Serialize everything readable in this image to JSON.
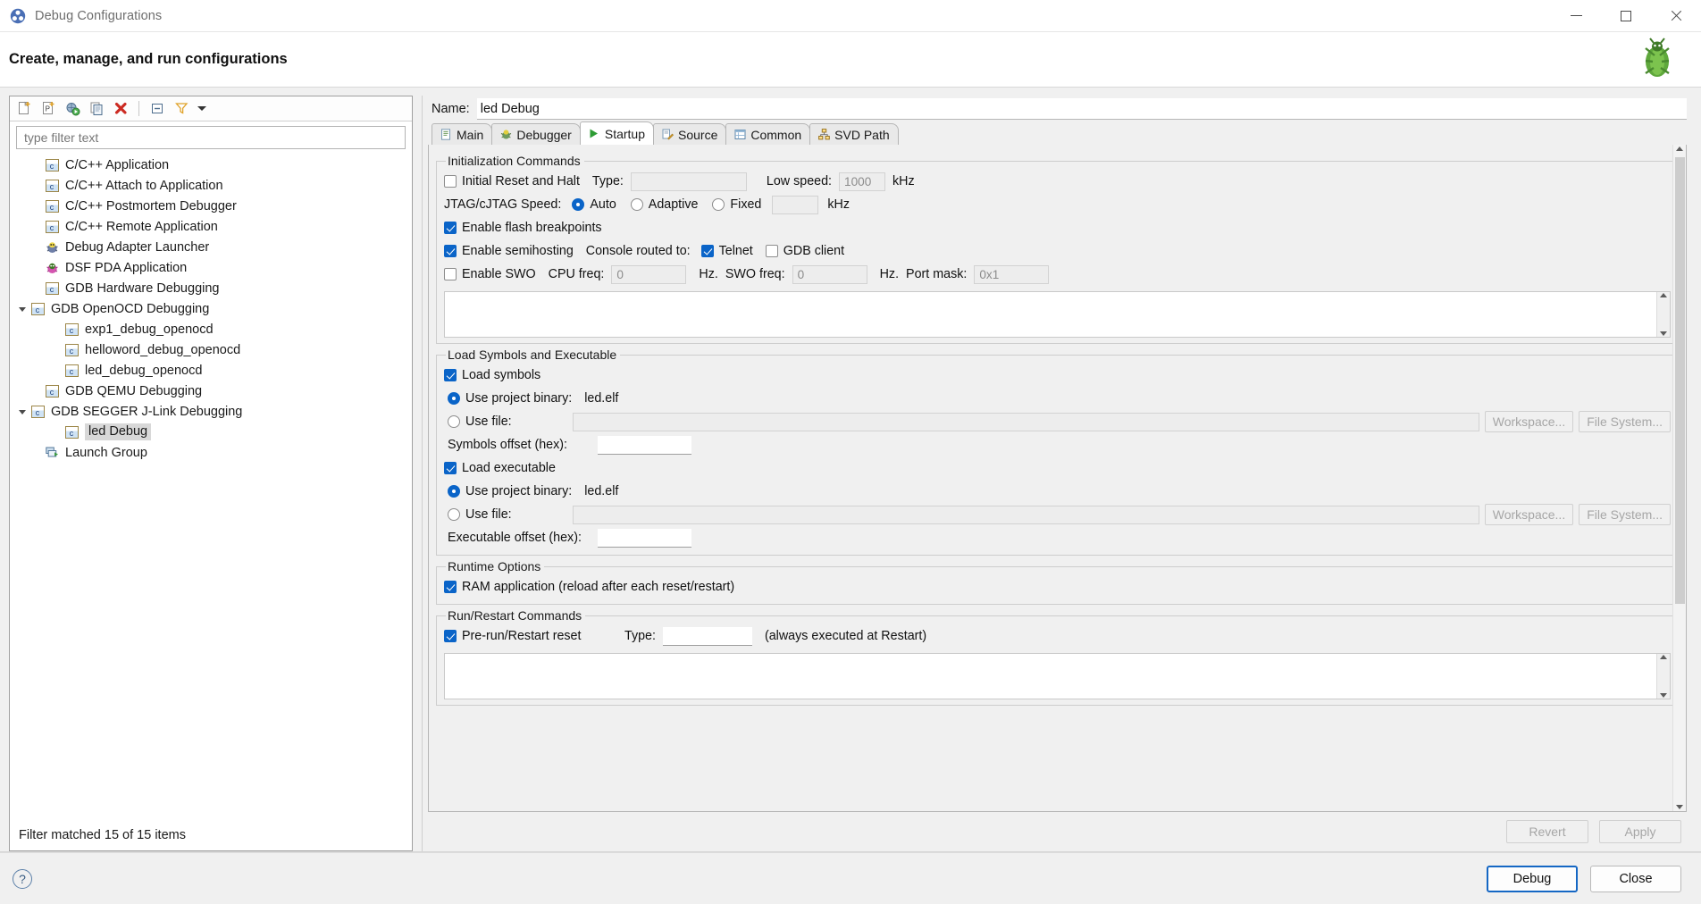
{
  "window": {
    "title": "Debug Configurations",
    "icon": "debug-configurations-icon",
    "minimize": "minimize-icon",
    "maximize": "maximize-icon",
    "close": "close-icon"
  },
  "banner": {
    "title": "Create, manage, and run configurations",
    "image": "bug-illustration"
  },
  "left": {
    "toolbar": [
      {
        "name": "new-launch-configuration-icon",
        "glyph": "❐"
      },
      {
        "name": "new-prototype-icon",
        "glyph": "P"
      },
      {
        "name": "export-icon",
        "glyph": "◐"
      },
      {
        "name": "duplicate-icon",
        "glyph": "⧉"
      },
      {
        "name": "delete-icon",
        "glyph": "✖"
      },
      {
        "name": "collapse-all-icon",
        "glyph": "⊟"
      },
      {
        "name": "filter-icon",
        "glyph": "▽"
      },
      {
        "name": "view-menu-caret-icon",
        "glyph": "▾"
      }
    ],
    "filter": {
      "placeholder": "type filter text",
      "value": ""
    },
    "tree": [
      {
        "label": "C/C++ Application",
        "icon": "c-config-icon",
        "indent": 1,
        "twisty": "",
        "selected": false
      },
      {
        "label": "C/C++ Attach to Application",
        "icon": "c-config-icon",
        "indent": 1,
        "twisty": "",
        "selected": false
      },
      {
        "label": "C/C++ Postmortem Debugger",
        "icon": "c-config-icon",
        "indent": 1,
        "twisty": "",
        "selected": false
      },
      {
        "label": "C/C++ Remote Application",
        "icon": "c-config-icon",
        "indent": 1,
        "twisty": "",
        "selected": false
      },
      {
        "label": "Debug Adapter Launcher",
        "icon": "bug-blue-icon",
        "indent": 1,
        "twisty": "",
        "selected": false
      },
      {
        "label": "DSF PDA Application",
        "icon": "bug-pink-icon",
        "indent": 1,
        "twisty": "",
        "selected": false
      },
      {
        "label": "GDB Hardware Debugging",
        "icon": "c-config-icon",
        "indent": 1,
        "twisty": "",
        "selected": false
      },
      {
        "label": "GDB OpenOCD Debugging",
        "icon": "c-config-icon",
        "indent": 0,
        "twisty": "open",
        "selected": false
      },
      {
        "label": "exp1_debug_openocd",
        "icon": "c-config-icon",
        "indent": 2,
        "twisty": "",
        "selected": false
      },
      {
        "label": "helloword_debug_openocd",
        "icon": "c-config-icon",
        "indent": 2,
        "twisty": "",
        "selected": false
      },
      {
        "label": "led_debug_openocd",
        "icon": "c-config-icon",
        "indent": 2,
        "twisty": "",
        "selected": false
      },
      {
        "label": "GDB QEMU Debugging",
        "icon": "c-config-icon",
        "indent": 1,
        "twisty": "",
        "selected": false
      },
      {
        "label": "GDB SEGGER J-Link Debugging",
        "icon": "c-config-icon",
        "indent": 0,
        "twisty": "open",
        "selected": false
      },
      {
        "label": "led Debug",
        "icon": "c-config-icon",
        "indent": 2,
        "twisty": "",
        "selected": true
      },
      {
        "label": "Launch Group",
        "icon": "launch-group-icon",
        "indent": 1,
        "twisty": "",
        "selected": false
      }
    ],
    "status": "Filter matched 15 of 15 items"
  },
  "right": {
    "name_label": "Name:",
    "name_value": "led Debug",
    "tabs": [
      {
        "label": "Main",
        "icon": "document-icon",
        "active": false
      },
      {
        "label": "Debugger",
        "icon": "debugger-icon",
        "active": false
      },
      {
        "label": "Startup",
        "icon": "play-icon",
        "active": true
      },
      {
        "label": "Source",
        "icon": "source-icon",
        "active": false
      },
      {
        "label": "Common",
        "icon": "common-icon",
        "active": false
      },
      {
        "label": "SVD Path",
        "icon": "svd-icon",
        "active": false
      }
    ],
    "startup": {
      "init_group": {
        "legend": "Initialization Commands",
        "initial_reset_label": "Initial Reset and Halt",
        "initial_reset_checked": false,
        "type_label": "Type:",
        "type_value": "",
        "low_speed_label": "Low speed:",
        "low_speed_value": "1000",
        "low_speed_unit": "kHz",
        "jtag_label": "JTAG/cJTAG Speed:",
        "jtag_options": [
          {
            "label": "Auto",
            "selected": true
          },
          {
            "label": "Adaptive",
            "selected": false
          },
          {
            "label": "Fixed",
            "selected": false
          }
        ],
        "fixed_value": "",
        "fixed_unit": "kHz",
        "flash_bp_label": "Enable flash breakpoints",
        "flash_bp_checked": true,
        "semihosting_label": "Enable semihosting",
        "semihosting_checked": true,
        "console_label": "Console routed to:",
        "telnet_label": "Telnet",
        "telnet_checked": true,
        "gdb_client_label": "GDB client",
        "gdb_client_checked": false,
        "swo_label": "Enable SWO",
        "swo_checked": false,
        "cpu_freq_label": "CPU freq:",
        "cpu_freq_value": "0",
        "cpu_freq_unit": "Hz.",
        "swo_freq_label": "SWO freq:",
        "swo_freq_value": "0",
        "swo_freq_unit": "Hz.",
        "port_mask_label": "Port mask:",
        "port_mask_value": "0x1",
        "commands_text": ""
      },
      "load_group": {
        "legend": "Load Symbols and Executable",
        "load_symbols_label": "Load symbols",
        "load_symbols_checked": true,
        "sym_project_binary_label": "Use project binary:",
        "sym_project_binary_value": "led.elf",
        "sym_project_binary_selected": true,
        "sym_use_file_label": "Use file:",
        "sym_use_file_selected": false,
        "sym_use_file_value": "",
        "workspace_button": "Workspace...",
        "filesystem_button": "File System...",
        "symbols_offset_label": "Symbols offset (hex):",
        "symbols_offset_value": "",
        "load_executable_label": "Load executable",
        "load_executable_checked": true,
        "exe_project_binary_label": "Use project binary:",
        "exe_project_binary_value": "led.elf",
        "exe_project_binary_selected": true,
        "exe_use_file_label": "Use file:",
        "exe_use_file_selected": false,
        "exe_use_file_value": "",
        "executable_offset_label": "Executable offset (hex):",
        "executable_offset_value": ""
      },
      "runtime_group": {
        "legend": "Runtime Options",
        "ram_app_label": "RAM application (reload after each reset/restart)",
        "ram_app_checked": true
      },
      "restart_group": {
        "legend": "Run/Restart Commands",
        "prerun_label": "Pre-run/Restart reset",
        "prerun_checked": true,
        "type_label": "Type:",
        "type_value": "",
        "note": "(always executed at Restart)",
        "commands_text": ""
      }
    },
    "revert_button": "Revert",
    "apply_button": "Apply"
  },
  "footer": {
    "help_icon": "help-icon",
    "debug_button": "Debug",
    "close_button": "Close"
  },
  "colors": {
    "accent": "#0a64c8",
    "selection": "#d8d8d8",
    "primary_border": "#1567c4",
    "background": "#f0f0f0"
  }
}
